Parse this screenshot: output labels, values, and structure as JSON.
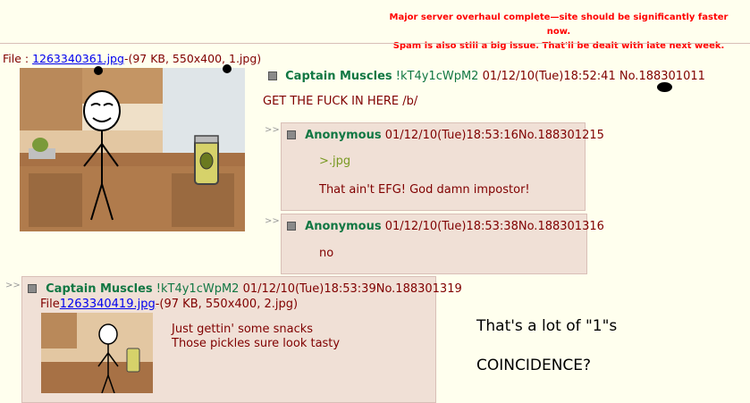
{
  "notice": {
    "line1": "Major server overhaul complete—site should be significantly faster now.",
    "line2": "Spam is also still a big issue. That'll be dealt with late next week."
  },
  "op": {
    "file_prefix": "File : ",
    "file_link": "1263340361.jpg",
    "file_info": "-(97 KB, 550x400, 1.jpg)",
    "name": "Captain Muscles",
    "trip": "!kT4y1cWpM2",
    "date": "01/12/10(Tue)18:52:41",
    "number": "No.188301011",
    "message": "GET THE FUCK IN HERE /b/"
  },
  "replies": [
    {
      "arrows": ">>",
      "name": "Anonymous",
      "date": "01/12/10(Tue)18:53:16",
      "number": "No.188301215",
      "quote": ">.jpg",
      "message": "That ain't EFG! God damn impostor!"
    },
    {
      "arrows": ">>",
      "name": "Anonymous",
      "date": "01/12/10(Tue)18:53:38",
      "number": "No.188301316",
      "message": "no"
    },
    {
      "arrows": ">>",
      "name": "Captain Muscles",
      "trip": "!kT4y1cWpM2",
      "date": "01/12/10(Tue)18:53:39",
      "number": "No.188301319",
      "file_prefix": "File",
      "file_link": "1263340419.jpg",
      "file_info": "-(97 KB, 550x400, 2.jpg)",
      "line1": "Just gettin' some snacks",
      "line2": "Those pickles sure look tasty"
    }
  ],
  "overlay": {
    "line1": "That's a lot of \"1\"s",
    "line2": "COINCIDENCE?"
  }
}
